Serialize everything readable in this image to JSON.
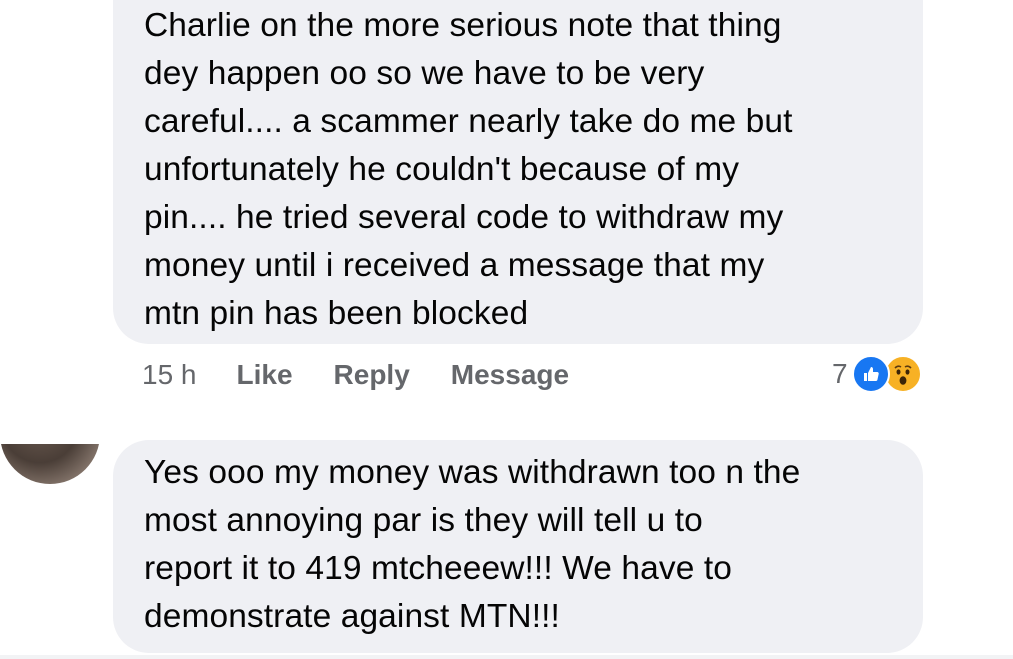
{
  "comments": [
    {
      "text": "Charlie on the more serious note that thing\ndey happen oo so we have to be very\ncareful.... a scammer nearly take do me but\nunfortunately he couldn't because of my\npin.... he tried several code to withdraw my\nmoney until i received a message that my\nmtn pin has been blocked",
      "time": "15 h",
      "actions": {
        "like": "Like",
        "reply": "Reply",
        "message": "Message"
      },
      "reactions": {
        "count": "7",
        "icons": [
          "like-icon",
          "wow-icon"
        ]
      }
    },
    {
      "text": "Yes ooo my money was withdrawn too n the\nmost annoying par is they will tell u to\nreport it to 419 mtcheeew!!! We have to\ndemonstrate against MTN!!!"
    }
  ],
  "colors": {
    "bubble": "#eff0f4",
    "like": "#1877f2",
    "wow": "#f7b125",
    "meta": "#65676b"
  }
}
